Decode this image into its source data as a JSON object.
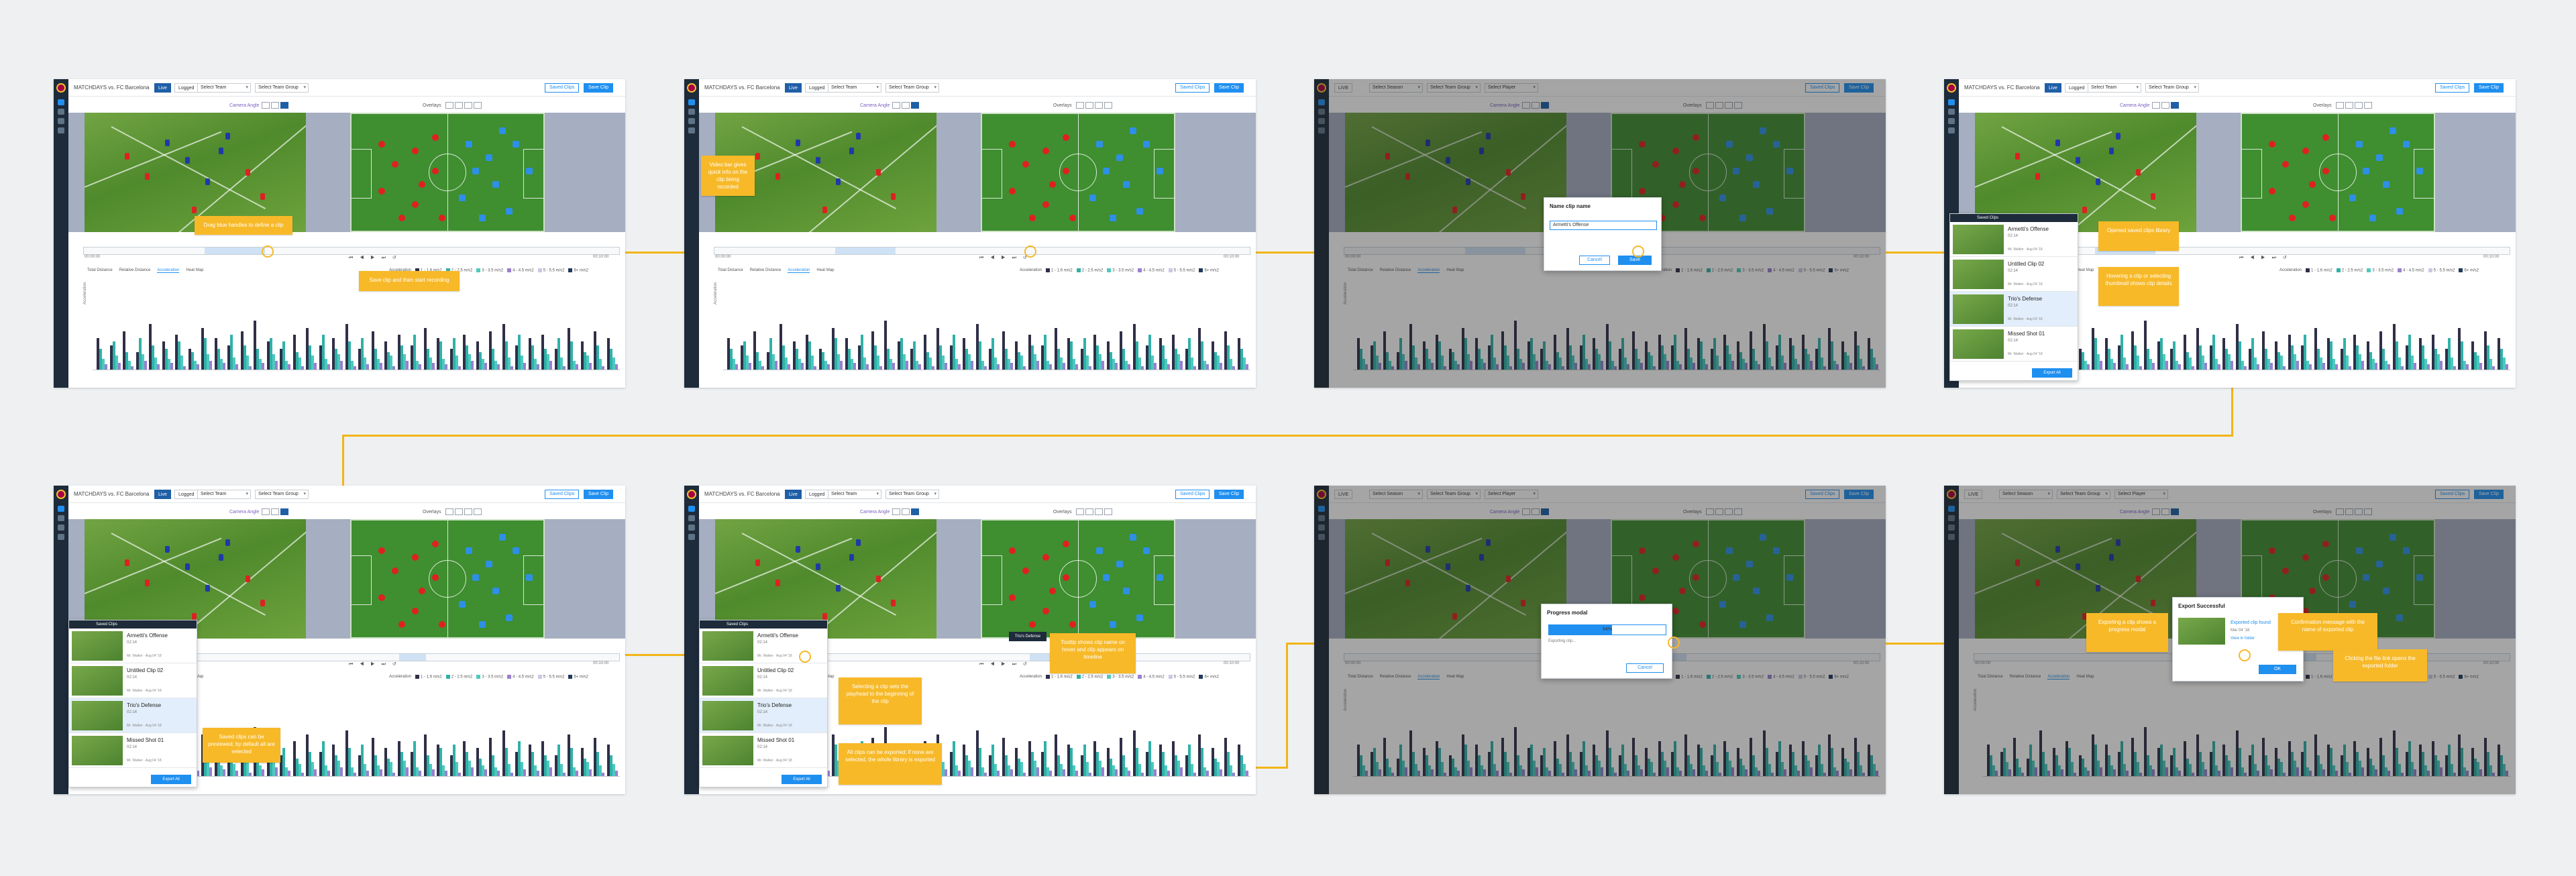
{
  "app": {
    "match_title": "MATCHDAYS vs. FC Barcelona",
    "tab_live": "Live",
    "tab_live_upper": "LIVE",
    "tab_logged": "Logged",
    "sel_team": "Select Team",
    "sel_teamgroup": "Select Team Group",
    "sel_player": "Select Player",
    "sel_season": "Select Season",
    "btn_saved": "Saved Clips",
    "btn_save": "Save Clip",
    "camera_label": "Camera Angle",
    "overlays_label": "Overlays",
    "time_start": "00:00:00",
    "time_end": "00:10:00",
    "playback": "⏮ ◀ ▶ ⏭ ↺",
    "chart_tabs": [
      "Total Distance",
      "Relative Distance",
      "Acceleration",
      "Heat Map"
    ],
    "legend_label": "Acceleration",
    "legend": [
      "1 - 1.6 m/s2",
      "2 - 2.5 m/s2",
      "3 - 3.5 m/s2",
      "4 - 4.5 m/s2",
      "5 - 5.5 m/s2",
      "6+ m/s2"
    ],
    "ylabel": "Acceleration",
    "xlabel": "Time (min)"
  },
  "colors": {
    "accent": "#1f8ff0",
    "note": "#f7b928",
    "navy": "#1d2b3a",
    "series": [
      "#2f2f48",
      "#30b1a8",
      "#4ec9c0",
      "#9a7fd0",
      "#c9c9e6",
      "#1f3a5c"
    ]
  },
  "saved_clips_header": "Saved Clips",
  "clips": [
    {
      "name": "Armetti's Offense",
      "time": "02:14",
      "meta": "Mr. Walker · Aug 04 '18"
    },
    {
      "name": "Untitled Clip 02",
      "time": "02:14",
      "meta": "Mr. Walker · Aug 04 '18"
    },
    {
      "name": "Trio's Defense",
      "time": "02:14",
      "meta": "Mr. Walker · Aug 04 '18"
    },
    {
      "name": "Missed Shot 01",
      "time": "02:14",
      "meta": "Mr. Walker · Aug 04 '18"
    }
  ],
  "export_all": "Export All",
  "save_dialog": {
    "title": "Name clip name",
    "value": "Armetti's Offense",
    "cancel": "Cancel",
    "save": "Save"
  },
  "progress_dialog": {
    "title": "Progress modal",
    "percent": "54%",
    "fill": 0.54,
    "sub": "Exporting clip...",
    "cancel": "Cancel"
  },
  "success_dialog": {
    "title": "Export Successful",
    "file": "Exported clip found",
    "meta": "Mar 04 '18",
    "link": "View in folder",
    "ok": "OK"
  },
  "tooltip_text": "Trio's Defense",
  "notes": {
    "n1": "Drag blue handles to define a clip",
    "n2": "Save clip and then start recording",
    "n3": "Video bar gives quick info on the clip being recorded",
    "n4": "Review clip name and confirm with save",
    "n5": "Opened saved clips library",
    "n6": "Hovering a clip or selecting thumbnail shows clip details",
    "n7": "Saved clips can be previewed, by default all are selected",
    "n8": "Selecting a clip sets the playhead to the beginning of the clip",
    "n9": "Tooltip shows clip name on hover and clip appears on timeline",
    "n10": "All clips can be exported; if none are selected, the whole library is exported",
    "n11": "Exporting a clip shows a progress modal",
    "n12": "Confirmation message with the name of exported clip",
    "n13": "Clicking the file link opens the exported folder"
  },
  "chart_data": {
    "type": "bar",
    "title": "",
    "xlabel": "Time (min)",
    "ylabel": "Acceleration",
    "series": [
      {
        "name": "1 - 1.6 m/s2",
        "values": [
          18,
          14,
          22,
          10,
          26,
          16,
          20,
          12,
          24,
          18,
          14,
          22,
          28,
          16,
          12,
          20,
          24,
          14,
          18,
          26,
          12,
          22,
          16,
          20,
          14,
          24,
          18,
          12,
          20,
          16,
          22,
          26,
          14,
          18,
          20,
          12,
          24,
          16,
          22,
          18
        ]
      },
      {
        "name": "2 - 2.5 m/s2",
        "values": [
          12,
          16,
          10,
          18,
          14,
          12,
          16,
          10,
          18,
          12,
          20,
          14,
          12,
          18,
          16,
          10,
          14,
          20,
          12,
          16,
          18,
          12,
          10,
          14,
          20,
          12,
          16,
          18,
          14,
          10,
          12,
          16,
          20,
          14,
          12,
          18,
          16,
          10,
          14,
          12
        ]
      },
      {
        "name": "3 - 3.5 m/s2",
        "values": [
          6,
          8,
          5,
          9,
          7,
          6,
          8,
          5,
          9,
          6,
          7,
          8,
          6,
          9,
          5,
          7,
          8,
          6,
          9,
          5,
          7,
          6,
          8,
          9,
          5,
          7,
          6,
          8,
          9,
          6,
          5,
          7,
          8,
          6,
          9,
          7,
          5,
          8,
          6,
          7
        ]
      },
      {
        "name": "4 - 4.5 m/s2",
        "values": [
          3,
          4,
          2,
          5,
          3,
          4,
          2,
          3,
          5,
          4,
          3,
          2,
          4,
          5,
          3,
          2,
          4,
          3,
          5,
          2,
          3,
          4,
          2,
          5,
          3,
          4,
          3,
          2,
          5,
          4,
          3,
          2,
          4,
          3,
          5,
          2,
          3,
          4,
          2,
          3
        ]
      }
    ]
  }
}
